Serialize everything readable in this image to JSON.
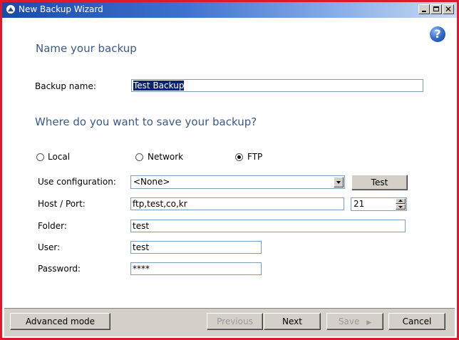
{
  "window": {
    "title": "New Backup Wizard",
    "buttons": {
      "minimize": "_",
      "maximize": "□",
      "close": "✕"
    }
  },
  "help": {
    "glyph": "?"
  },
  "section1": {
    "heading": "Name your backup"
  },
  "backup_name": {
    "label": "Backup name:",
    "value": "Test Backup"
  },
  "section2": {
    "heading": "Where do you want to save your backup?"
  },
  "destination": {
    "options": [
      {
        "label": "Local",
        "checked": false
      },
      {
        "label": "Network",
        "checked": false
      },
      {
        "label": "FTP",
        "checked": true
      }
    ]
  },
  "ftp": {
    "configuration": {
      "label": "Use configuration:",
      "value": "<None>"
    },
    "test_button": "Test",
    "host_port": {
      "label": "Host / Port:",
      "host": "ftp,test,co,kr",
      "port": "21"
    },
    "folder": {
      "label": "Folder:",
      "value": "test"
    },
    "user": {
      "label": "User:",
      "value": "test"
    },
    "password": {
      "label": "Password:",
      "value": "****"
    }
  },
  "footer": {
    "advanced_mode": "Advanced mode",
    "previous": "Previous",
    "next": "Next",
    "save": "Save",
    "save_arrow": "▶",
    "cancel": "Cancel"
  },
  "colors": {
    "titlebar_start": "#1a4ba8",
    "heading": "#3c5a82",
    "window_border": "#e0182c",
    "selection": "#0a246a",
    "button_face": "#d4d0c8"
  }
}
